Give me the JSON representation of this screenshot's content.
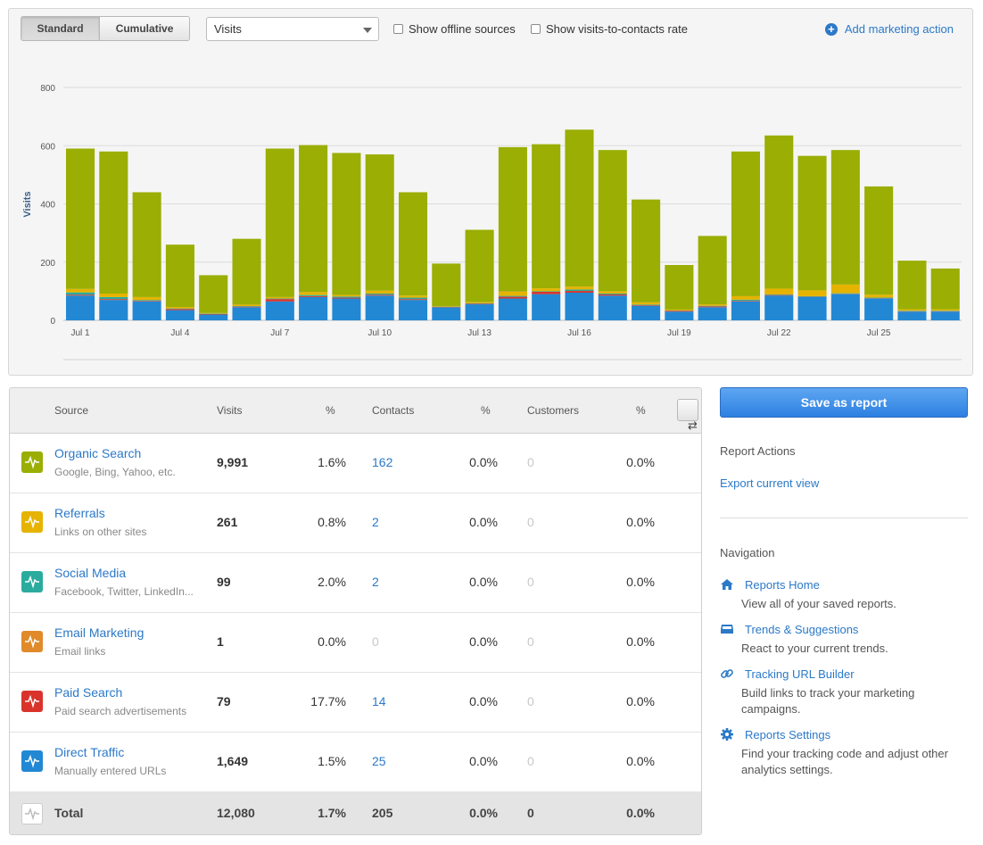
{
  "toolbar": {
    "mode_standard": "Standard",
    "mode_cumulative": "Cumulative",
    "metric_select": "Visits",
    "show_offline": "Show offline sources",
    "show_rate": "Show visits-to-contacts rate",
    "add_action": "Add marketing action"
  },
  "colors": {
    "organic": "#9aae04",
    "referrals": "#e6b300",
    "social": "#2aab9e",
    "email": "#e08a2a",
    "paid": "#d9342b",
    "direct": "#2288d4"
  },
  "chart_data": {
    "type": "bar",
    "stacked": true,
    "ylabel": "Visits",
    "ylim": [
      0,
      800
    ],
    "yticks": [
      0,
      200,
      400,
      600,
      800
    ],
    "grid": true,
    "x_tick_labels": [
      "Jul 1",
      "Jul 4",
      "Jul 7",
      "Jul 10",
      "Jul 13",
      "Jul 16",
      "Jul 19",
      "Jul 22",
      "Jul 25"
    ],
    "x_tick_indices": [
      0,
      3,
      6,
      9,
      12,
      15,
      18,
      21,
      24
    ],
    "categories": [
      "Jul 1",
      "Jul 2",
      "Jul 3",
      "Jul 4",
      "Jul 5",
      "Jul 6",
      "Jul 7",
      "Jul 8",
      "Jul 9",
      "Jul 10",
      "Jul 11",
      "Jul 12",
      "Jul 13",
      "Jul 14",
      "Jul 15",
      "Jul 16",
      "Jul 17",
      "Jul 18",
      "Jul 19",
      "Jul 20",
      "Jul 21",
      "Jul 22",
      "Jul 23",
      "Jul 24",
      "Jul 25",
      "Jul 26",
      "Jul 27"
    ],
    "series": [
      {
        "name": "Direct Traffic",
        "color_key": "direct",
        "values": [
          85,
          70,
          65,
          35,
          20,
          45,
          65,
          80,
          75,
          85,
          70,
          45,
          55,
          75,
          90,
          95,
          85,
          50,
          30,
          45,
          65,
          85,
          80,
          90,
          75,
          30,
          30
        ]
      },
      {
        "name": "Paid Search",
        "color_key": "paid",
        "values": [
          3,
          3,
          2,
          4,
          2,
          2,
          8,
          3,
          3,
          3,
          3,
          1,
          2,
          6,
          8,
          6,
          4,
          2,
          3,
          3,
          2,
          2,
          1,
          1,
          1,
          1,
          1
        ]
      },
      {
        "name": "Email Marketing",
        "color_key": "email",
        "values": [
          0,
          0,
          0,
          0,
          0,
          0,
          0,
          0,
          0,
          0,
          0,
          0,
          0,
          0,
          0,
          0,
          0,
          0,
          0,
          0,
          0,
          0,
          0,
          0,
          0,
          0,
          0
        ]
      },
      {
        "name": "Social Media",
        "color_key": "social",
        "values": [
          8,
          7,
          3,
          2,
          1,
          2,
          2,
          4,
          4,
          4,
          5,
          1,
          2,
          3,
          2,
          5,
          3,
          2,
          1,
          2,
          4,
          2,
          2,
          2,
          2,
          2,
          2
        ]
      },
      {
        "name": "Referrals",
        "color_key": "referrals",
        "values": [
          12,
          12,
          10,
          5,
          2,
          5,
          5,
          10,
          5,
          10,
          7,
          2,
          4,
          15,
          10,
          10,
          8,
          8,
          3,
          5,
          12,
          20,
          20,
          30,
          10,
          5,
          5
        ]
      },
      {
        "name": "Organic Search",
        "color_key": "organic",
        "values": [
          482,
          488,
          360,
          214,
          130,
          226,
          510,
          505,
          488,
          468,
          355,
          146,
          248,
          496,
          495,
          539,
          485,
          353,
          153,
          235,
          497,
          526,
          462,
          462,
          372,
          167,
          140
        ]
      }
    ]
  },
  "table": {
    "headers": {
      "source": "Source",
      "visits": "Visits",
      "pct1": "%",
      "contacts": "Contacts",
      "pct2": "%",
      "customers": "Customers",
      "pct3": "%"
    },
    "rows": [
      {
        "name": "Organic Search",
        "desc": "Google, Bing, Yahoo, etc.",
        "icon": "pulse-icon",
        "color_key": "organic",
        "visits": "9,991",
        "pct1": "1.6%",
        "contacts": "162",
        "pct2": "0.0%",
        "customers": "0",
        "pct3": "0.0%"
      },
      {
        "name": "Referrals",
        "desc": "Links on other sites",
        "icon": "pulse-icon",
        "color_key": "referrals",
        "visits": "261",
        "pct1": "0.8%",
        "contacts": "2",
        "pct2": "0.0%",
        "customers": "0",
        "pct3": "0.0%"
      },
      {
        "name": "Social Media",
        "desc": "Facebook, Twitter, LinkedIn...",
        "icon": "pulse-icon",
        "color_key": "social",
        "visits": "99",
        "pct1": "2.0%",
        "contacts": "2",
        "pct2": "0.0%",
        "customers": "0",
        "pct3": "0.0%"
      },
      {
        "name": "Email Marketing",
        "desc": "Email links",
        "icon": "pulse-icon",
        "color_key": "email",
        "visits": "1",
        "pct1": "0.0%",
        "contacts": "0",
        "pct2": "0.0%",
        "customers": "0",
        "pct3": "0.0%"
      },
      {
        "name": "Paid Search",
        "desc": "Paid search advertisements",
        "icon": "pulse-icon",
        "color_key": "paid",
        "visits": "79",
        "pct1": "17.7%",
        "contacts": "14",
        "pct2": "0.0%",
        "customers": "0",
        "pct3": "0.0%"
      },
      {
        "name": "Direct Traffic",
        "desc": "Manually entered URLs",
        "icon": "pulse-icon",
        "color_key": "direct",
        "visits": "1,649",
        "pct1": "1.5%",
        "contacts": "25",
        "pct2": "0.0%",
        "customers": "0",
        "pct3": "0.0%"
      }
    ],
    "total": {
      "name": "Total",
      "visits": "12,080",
      "pct1": "1.7%",
      "contacts": "205",
      "pct2": "0.0%",
      "customers": "0",
      "pct3": "0.0%"
    }
  },
  "sidebar": {
    "save_report": "Save as report",
    "report_actions_heading": "Report Actions",
    "export_link": "Export current view",
    "navigation_heading": "Navigation",
    "nav": [
      {
        "label": "Reports Home",
        "desc": "View all of your saved reports.",
        "icon": "home-icon"
      },
      {
        "label": "Trends & Suggestions",
        "desc": "React to your current trends.",
        "icon": "tray-icon"
      },
      {
        "label": "Tracking URL Builder",
        "desc": "Build links to track your marketing campaigns.",
        "icon": "link-icon"
      },
      {
        "label": "Reports Settings",
        "desc": "Find your tracking code and adjust other analytics settings.",
        "icon": "gear-icon"
      }
    ]
  }
}
